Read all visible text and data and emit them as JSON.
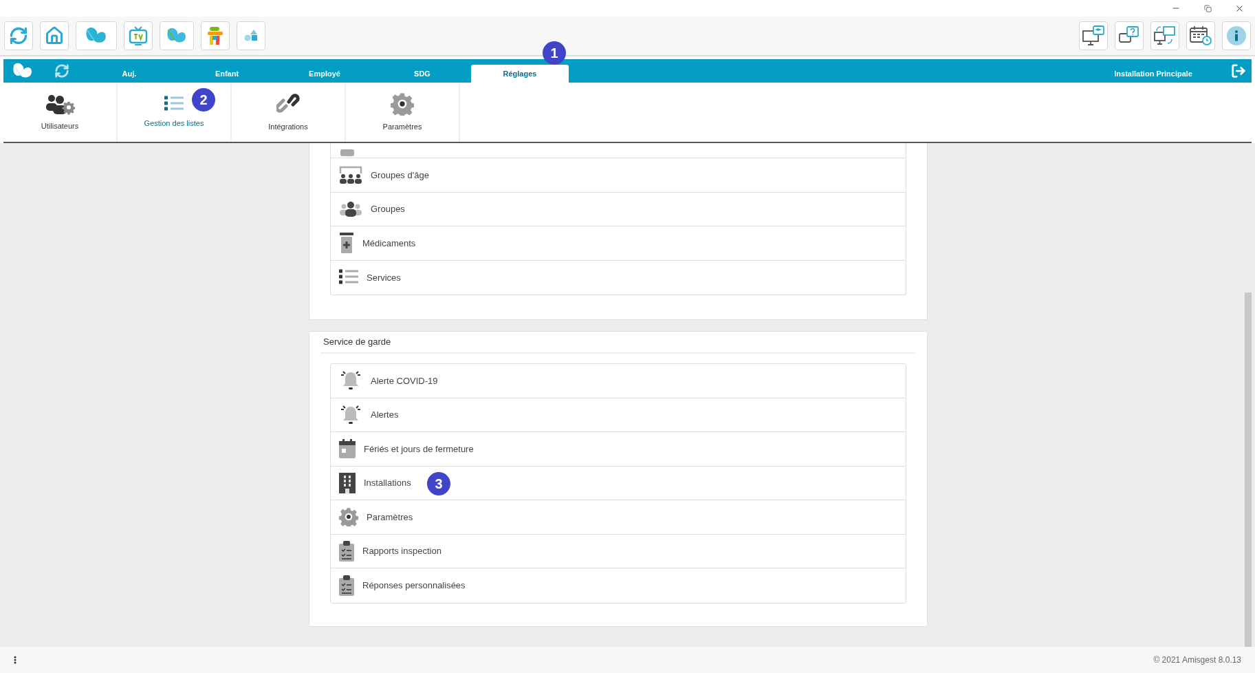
{
  "nav": {
    "tabs": [
      {
        "label": "Auj.",
        "selected": false
      },
      {
        "label": "Enfant",
        "selected": false
      },
      {
        "label": "Employé",
        "selected": false
      },
      {
        "label": "SDG",
        "selected": false
      },
      {
        "label": "Réglages",
        "selected": true,
        "badge": "1"
      }
    ],
    "installation": "Installation Principale"
  },
  "submenu": [
    {
      "label": "Utilisateurs",
      "kind": "users",
      "selected": false
    },
    {
      "label": "Gestion des listes",
      "kind": "list",
      "selected": true,
      "badge": "2"
    },
    {
      "label": "Intégrations",
      "kind": "link",
      "selected": false
    },
    {
      "label": "Paramètres",
      "kind": "gear",
      "selected": false
    }
  ],
  "sections": [
    {
      "items": [
        {
          "kind": "partial"
        },
        {
          "label": "Groupes d'âge",
          "kind": "age-groups"
        },
        {
          "label": "Groupes",
          "kind": "groups"
        },
        {
          "label": "Médicaments",
          "kind": "medicine"
        },
        {
          "label": "Services",
          "kind": "list"
        }
      ]
    },
    {
      "title": "Service de garde",
      "items": [
        {
          "label": "Alerte COVID-19",
          "kind": "bell"
        },
        {
          "label": "Alertes",
          "kind": "bell"
        },
        {
          "label": "Fériés et jours de fermeture",
          "kind": "calendar"
        },
        {
          "label": "Installations",
          "kind": "building",
          "badge": "3"
        },
        {
          "label": "Paramètres",
          "kind": "gear"
        },
        {
          "label": "Rapports inspection",
          "kind": "clipboard"
        },
        {
          "label": "Réponses personnalisées",
          "kind": "clipboard"
        }
      ]
    }
  ],
  "footer": "© 2021 Amisgest 8.0.13"
}
